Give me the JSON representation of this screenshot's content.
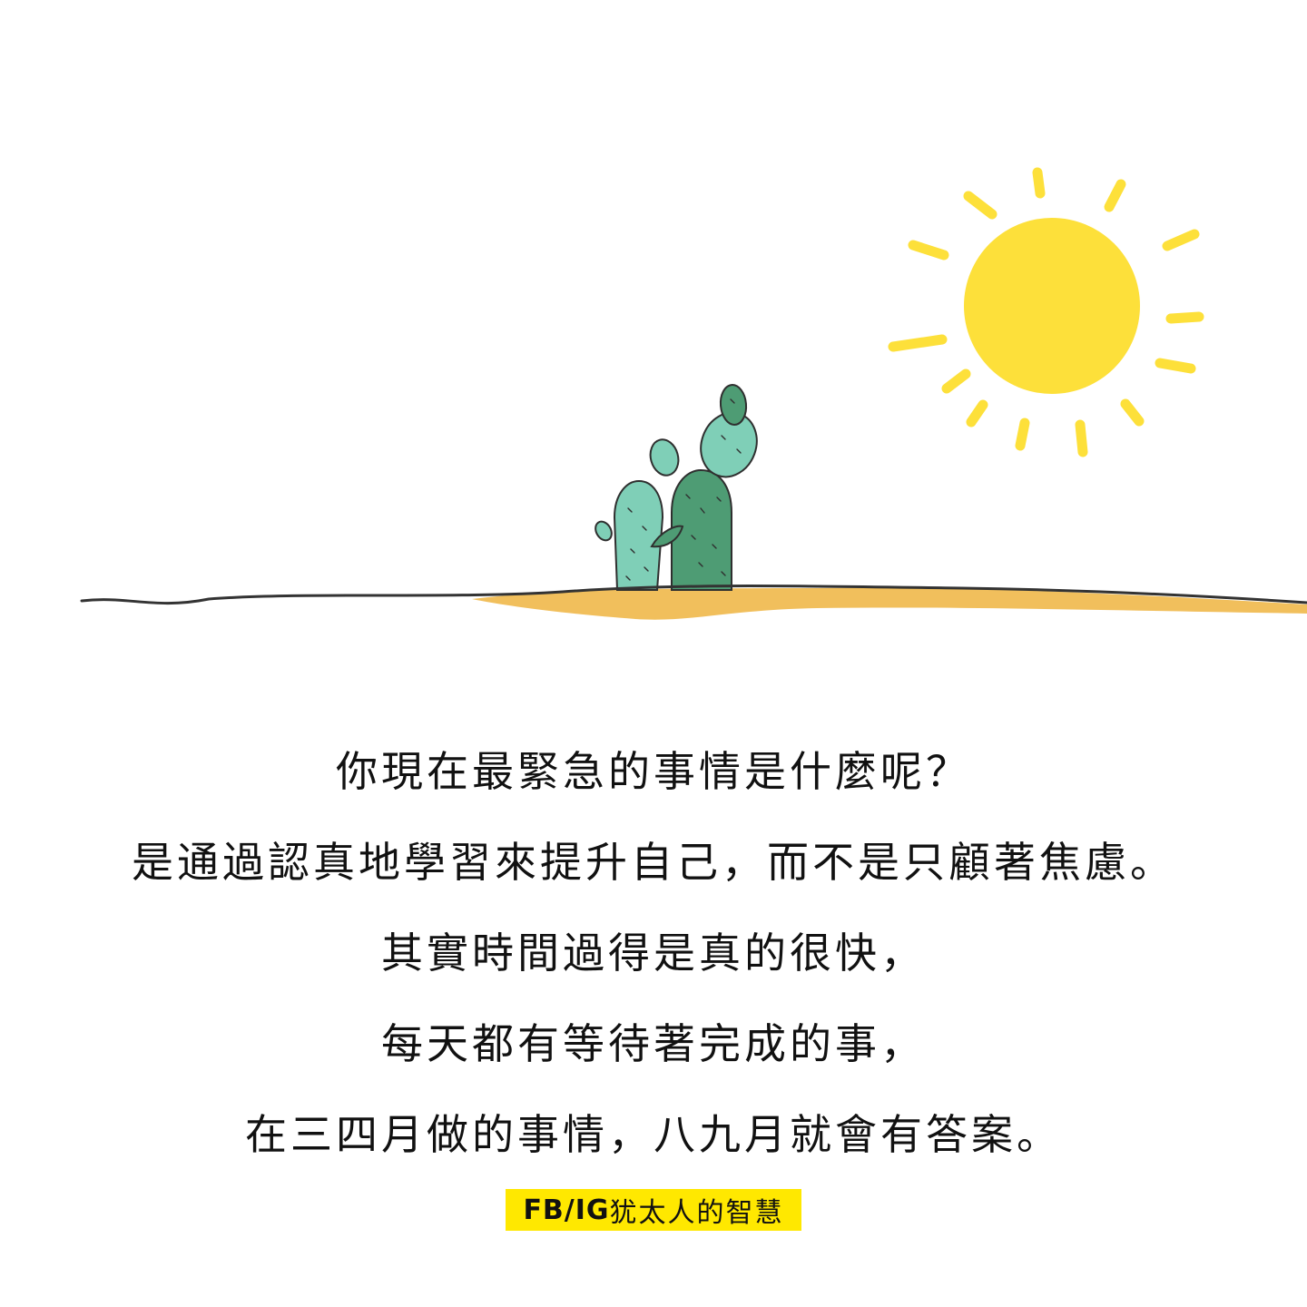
{
  "quote": {
    "lines": [
      "你現在最緊急的事情是什麼呢？",
      "是通過認真地學習來提升自己，而不是只顧著焦慮。",
      "其實時間過得是真的很快，",
      "每天都有等待著完成的事，",
      "在三四月做的事情，八九月就會有答案。"
    ]
  },
  "footer": {
    "prefix": "FB/IG",
    "name": "犹太人的智慧"
  },
  "colors": {
    "sun": "#fde03a",
    "sand": "#f0b84a",
    "cactus_light": "#7fcfb7",
    "cactus_dark": "#4e9c74",
    "highlight": "#ffe800",
    "text": "#111111"
  }
}
